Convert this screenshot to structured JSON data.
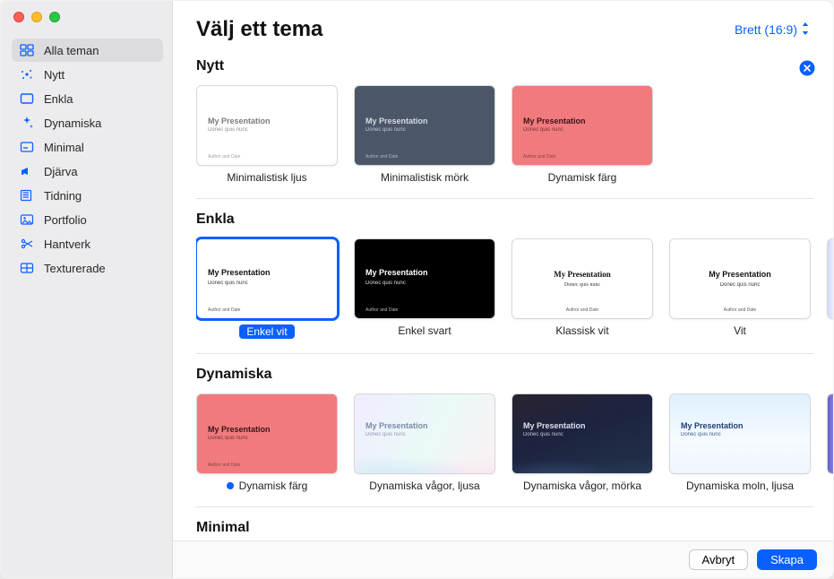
{
  "header": {
    "title": "Välj ett tema"
  },
  "aspect": {
    "label": "Brett (16:9)"
  },
  "preview": {
    "title": "My Presentation",
    "subtitle": "Donec quis nunc",
    "footer": "Author and Date"
  },
  "sidebar": {
    "items": [
      {
        "label": "Alla teman"
      },
      {
        "label": "Nytt"
      },
      {
        "label": "Enkla"
      },
      {
        "label": "Dynamiska"
      },
      {
        "label": "Minimal"
      },
      {
        "label": "Djärva"
      },
      {
        "label": "Tidning"
      },
      {
        "label": "Portfolio"
      },
      {
        "label": "Hantverk"
      },
      {
        "label": "Texturerade"
      }
    ]
  },
  "sections": {
    "nytt": {
      "title": "Nytt",
      "themes": [
        {
          "label": "Minimalistisk ljus"
        },
        {
          "label": "Minimalistisk mörk"
        },
        {
          "label": "Dynamisk färg"
        }
      ]
    },
    "enkla": {
      "title": "Enkla",
      "themes": [
        {
          "label": "Enkel vit"
        },
        {
          "label": "Enkel svart"
        },
        {
          "label": "Klassisk vit"
        },
        {
          "label": "Vit"
        }
      ]
    },
    "dynamiska": {
      "title": "Dynamiska",
      "themes": [
        {
          "label": "Dynamisk färg"
        },
        {
          "label": "Dynamiska vågor, ljusa"
        },
        {
          "label": "Dynamiska vågor, mörka"
        },
        {
          "label": "Dynamiska moln, ljusa"
        }
      ]
    },
    "minimal": {
      "title": "Minimal"
    }
  },
  "footer": {
    "cancel": "Avbryt",
    "create": "Skapa"
  }
}
